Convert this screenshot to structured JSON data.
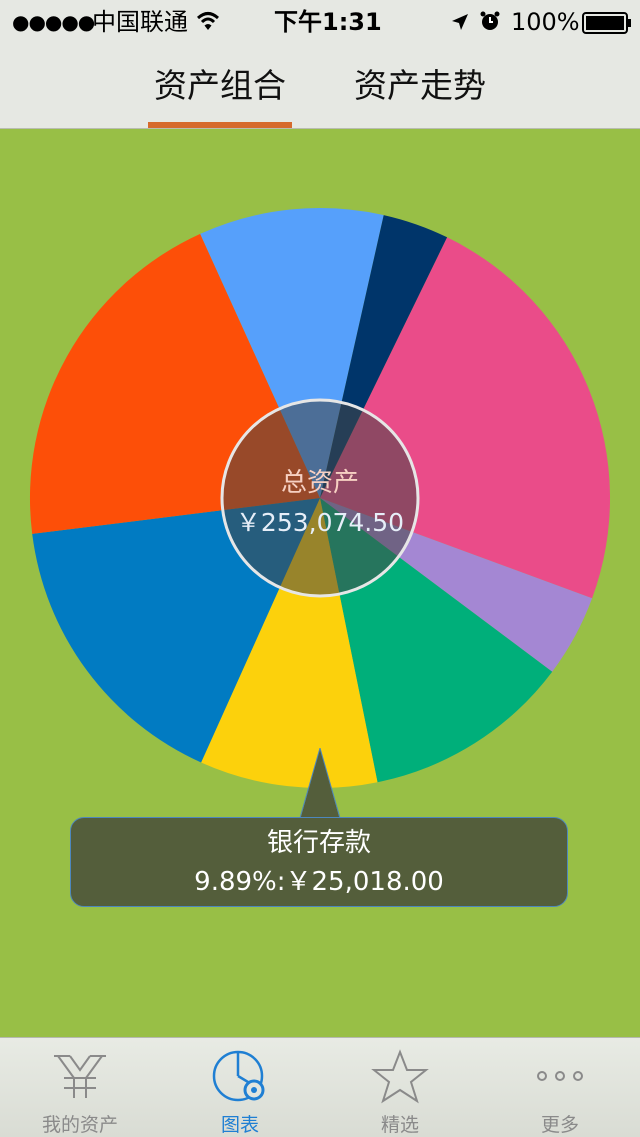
{
  "status_bar": {
    "signal": "●●●●●",
    "carrier": "中国联通",
    "time": "下午1:31",
    "battery": "100%"
  },
  "header": {
    "tabs": [
      {
        "label": "资产组合",
        "active": true
      },
      {
        "label": "资产走势",
        "active": false
      }
    ],
    "accent": "#d66a2d"
  },
  "chart": {
    "center_label": "总资产",
    "center_value": "￥253,074.50",
    "tooltip": {
      "title": "银行存款",
      "value": "9.89%:￥25,018.00"
    }
  },
  "chart_data": {
    "type": "pie",
    "slices": [
      {
        "color": "#ea4c89",
        "fraction": 0.234
      },
      {
        "color": "#a487d3",
        "fraction": 0.046
      },
      {
        "color": "#00af7a",
        "fraction": 0.116
      },
      {
        "color": "#fcd10c",
        "fraction": 0.099
      },
      {
        "color": "#017bc2",
        "fraction": 0.163
      },
      {
        "color": "#fd4f08",
        "fraction": 0.202
      },
      {
        "color": "#56a0fb",
        "fraction": 0.103
      },
      {
        "color": "#00356a",
        "fraction": 0.037
      }
    ],
    "highlighted": "银行存款"
  },
  "tab_bar": {
    "items": [
      {
        "label": "我的资产",
        "icon": "yen-icon",
        "active": false
      },
      {
        "label": "图表",
        "icon": "chart-settings-icon",
        "active": true
      },
      {
        "label": "精选",
        "icon": "star-icon",
        "active": false
      },
      {
        "label": "更多",
        "icon": "more-icon",
        "active": false
      }
    ],
    "active_color": "#1f7fd3"
  }
}
